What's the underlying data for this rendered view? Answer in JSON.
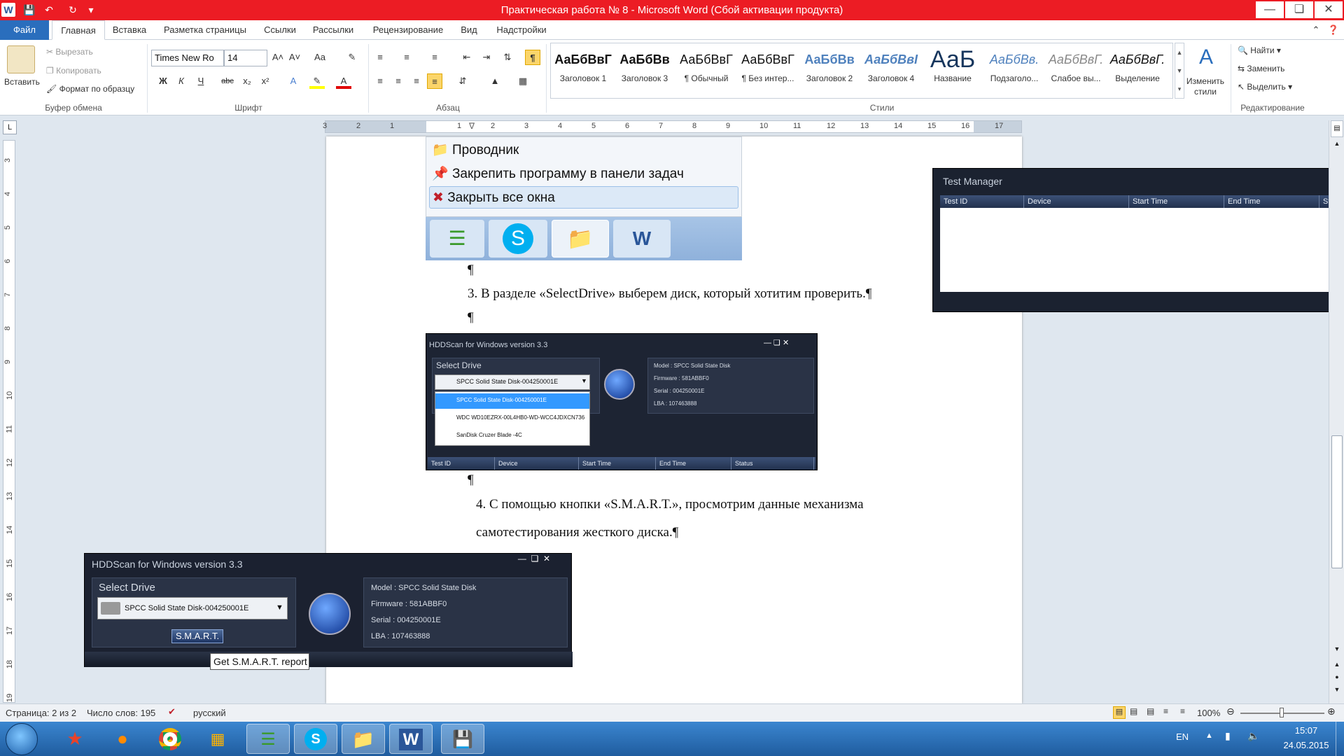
{
  "titlebar": {
    "title": "Практическая работа № 8 - Microsoft Word (Сбой активации продукта)"
  },
  "tabs": [
    "Файл",
    "Главная",
    "Вставка",
    "Разметка страницы",
    "Ссылки",
    "Рассылки",
    "Рецензирование",
    "Вид",
    "Надстройки"
  ],
  "clipboard": {
    "paste": "Вставить",
    "cut": "Вырезать",
    "copy": "Копировать",
    "format_painter": "Формат по образцу",
    "group": "Буфер обмена"
  },
  "font": {
    "name": "Times New Ro",
    "size": "14",
    "group": "Шрифт",
    "bold": "Ж",
    "italic": "К",
    "underline": "Ч",
    "strike": "abc"
  },
  "paragraph": {
    "group": "Абзац",
    "pilcrow": "¶"
  },
  "styles": {
    "group": "Стили",
    "items": [
      {
        "sample": "АаБбВвГ",
        "name": "Заголовок 1"
      },
      {
        "sample": "АаБбВв",
        "name": "Заголовок 3"
      },
      {
        "sample": "АаБбВвГ",
        "name": "¶ Обычный"
      },
      {
        "sample": "АаБбВвГ",
        "name": "¶ Без интер..."
      },
      {
        "sample": "АаБбВв",
        "name": "Заголовок 2"
      },
      {
        "sample": "АаБбВвІ",
        "name": "Заголовок 4"
      },
      {
        "sample": "АаБ",
        "name": "Название"
      },
      {
        "sample": "АаБбВв.",
        "name": "Подзаголо..."
      },
      {
        "sample": "АаБбВвГ.",
        "name": "Слабое вы..."
      },
      {
        "sample": "АаБбВвГ.",
        "name": "Выделение"
      }
    ],
    "change": "Изменить стили"
  },
  "editing": {
    "group": "Редактирование",
    "find": "Найти",
    "replace": "Заменить",
    "select": "Выделить"
  },
  "jumplist": {
    "items": [
      "Проводник",
      "Закрепить программу в панели задач",
      "Закрыть все окна"
    ]
  },
  "document": {
    "p_mark": "¶",
    "step3": "3. В разделе «SelectDrive» выберем диск, который хотитим проверить.¶",
    "step4_line1": "4.  С  помощью  кнопки  «S.M.A.R.T.»,  просмотрим  данные  механизма",
    "step4_line2": "самотестирования жесткого диска.¶"
  },
  "hdd_small": {
    "title": "HDDScan for Windows version 3.3",
    "select_label": "Select Drive",
    "selected": "SPCC Solid State Disk-004250001E",
    "options": [
      "SPCC Solid State Disk-004250001E",
      "WDC WD10EZRX-00L4HB0-WD-WCC4JDXCN736",
      "SanDisk Cruzer Blade   -4C"
    ],
    "info": [
      "Model : SPCC Solid State Disk",
      "Firmware : 581ABBF0",
      "Serial : 004250001E",
      "LBA : 107463888"
    ],
    "columns": [
      "Test ID",
      "Device",
      "Start Time",
      "End Time",
      "Status"
    ]
  },
  "hdd_big": {
    "title": "HDDScan for Windows version 3.3",
    "select_label": "Select Drive",
    "selected": "SPCC Solid State Disk-004250001E",
    "smart": "S.M.A.R.T.",
    "tooltip": "Get S.M.A.R.T. report",
    "info": [
      "Model : SPCC Solid State Disk",
      "Firmware : 581ABBF0",
      "Serial : 004250001E",
      "LBA : 107463888"
    ]
  },
  "test_manager": {
    "title": "Test Manager",
    "columns": [
      "Test ID",
      "Device",
      "Start Time",
      "End Time",
      "Status"
    ]
  },
  "statusbar": {
    "page": "Страница: 2 из 2",
    "words": "Число слов: 195",
    "lang": "русский",
    "zoom": "100%"
  },
  "tray": {
    "lang": "EN",
    "time": "15:07",
    "date": "24.05.2015"
  },
  "colors": {
    "title_red": "#ec1c24",
    "file_tab": "#2a6ebd",
    "taskbar": "#2a6db5"
  }
}
